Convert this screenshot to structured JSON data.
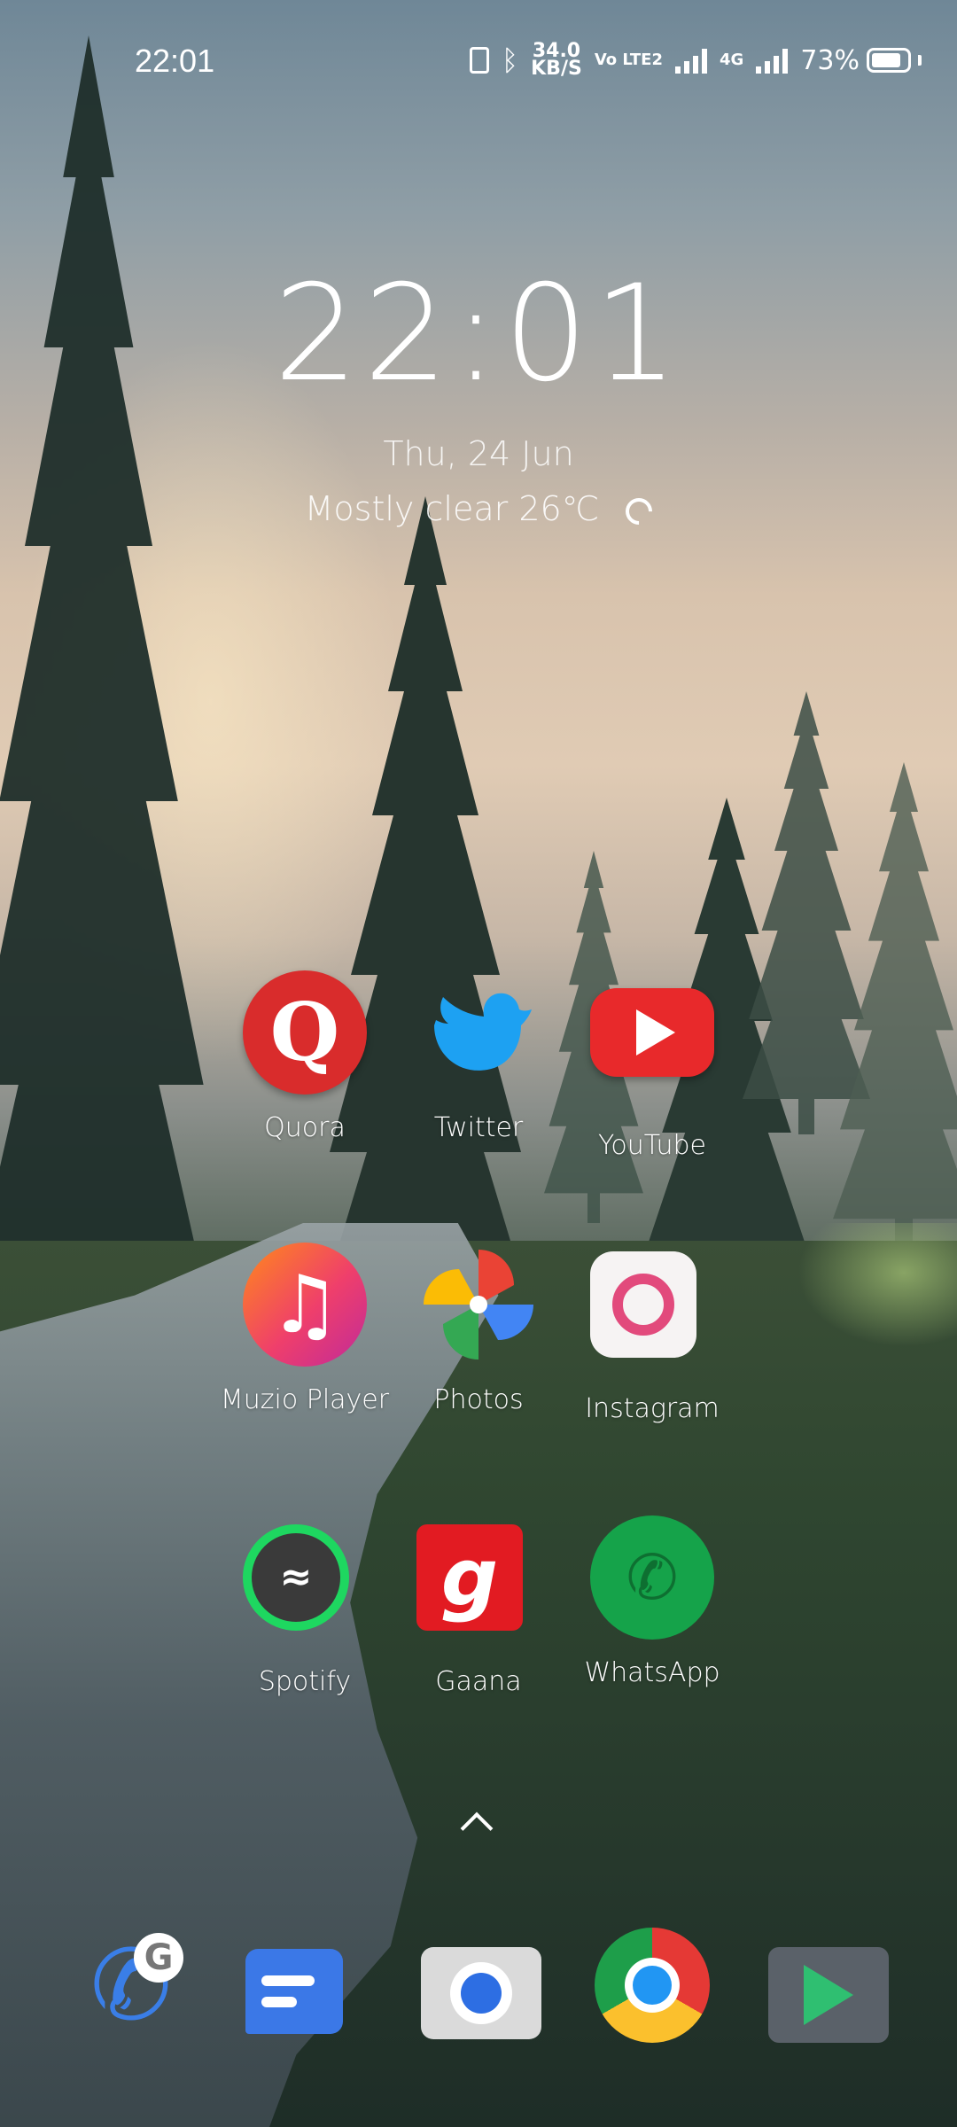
{
  "status_bar": {
    "time": "22:01",
    "speed_value": "34.0",
    "speed_unit": "KB/S",
    "volte": "Vo LTE2",
    "network": "4G",
    "battery_percent": "73%"
  },
  "clock_widget": {
    "time": "22:01",
    "date": "Thu, 24 Jun",
    "weather": "Mostly clear 26℃"
  },
  "apps": [
    {
      "label": "Quora",
      "icon": "quora-icon"
    },
    {
      "label": "Twitter",
      "icon": "twitter-icon"
    },
    {
      "label": "YouTube",
      "icon": "youtube-icon"
    },
    {
      "label": "Muzio Player",
      "icon": "music-note-icon"
    },
    {
      "label": "Photos",
      "icon": "pinwheel-icon"
    },
    {
      "label": "Instagram",
      "icon": "instagram-icon"
    },
    {
      "label": "Spotify",
      "icon": "spotify-icon"
    },
    {
      "label": "Gaana",
      "icon": "gaana-icon"
    },
    {
      "label": "WhatsApp",
      "icon": "whatsapp-icon"
    }
  ],
  "dock": [
    {
      "icon": "phone-icon"
    },
    {
      "icon": "messages-icon"
    },
    {
      "icon": "camera-icon"
    },
    {
      "icon": "chrome-icon"
    },
    {
      "icon": "play-store-icon"
    }
  ],
  "glyphs": {
    "quora": "Q",
    "music": "♫",
    "gaana": "g",
    "whatsapp": "✆",
    "phone": "✆",
    "phone_badge": "G",
    "bluetooth": "ᛒ"
  },
  "colors": {
    "quora": "#d92c2c",
    "youtube": "#e8292b",
    "whatsapp": "#15a34a",
    "spotify": "#1ed760",
    "gaana": "#e21b22",
    "twitter": "#1da1f2"
  }
}
